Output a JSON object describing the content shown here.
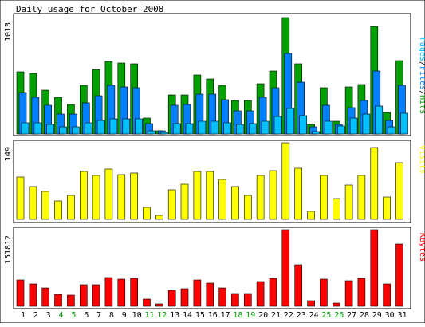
{
  "title": "Daily usage for October 2008",
  "days": [
    "1",
    "2",
    "3",
    "4",
    "5",
    "6",
    "7",
    "8",
    "9",
    "10",
    "11",
    "12",
    "13",
    "14",
    "15",
    "16",
    "17",
    "18",
    "19",
    "20",
    "21",
    "22",
    "23",
    "24",
    "25",
    "26",
    "27",
    "28",
    "29",
    "30",
    "31"
  ],
  "weekend_days": [
    "4",
    "5",
    "11",
    "12",
    "18",
    "19",
    "25",
    "26"
  ],
  "panels": {
    "top": {
      "max_label": "1013",
      "legend": {
        "pages": "Pages",
        "sep1": "/",
        "files": "Files",
        "sep2": "/",
        "hits": "Hits"
      }
    },
    "middle": {
      "max_label": "149",
      "legend": "Visits"
    },
    "bottom": {
      "max_label": "151812",
      "legend": "KBytes"
    }
  },
  "colors": {
    "hits": "#00a000",
    "files": "#0080ff",
    "pages": "#00c0ff",
    "visits": "#ffff00",
    "kbytes": "#ff0000",
    "weekend_text": "#00a000",
    "weekday_text": "#000000",
    "border": "#000000",
    "panel_bg": "#ffffff",
    "page_bg": "#ffffff"
  },
  "chart_data": [
    {
      "type": "bar",
      "title": "Daily usage for October 2008",
      "categories": [
        "1",
        "2",
        "3",
        "4",
        "5",
        "6",
        "7",
        "8",
        "9",
        "10",
        "11",
        "12",
        "13",
        "14",
        "15",
        "16",
        "17",
        "18",
        "19",
        "20",
        "21",
        "22",
        "23",
        "24",
        "25",
        "26",
        "27",
        "28",
        "29",
        "30",
        "31"
      ],
      "ylim": [
        0,
        1013
      ],
      "series": [
        {
          "name": "Hits",
          "values": [
            540,
            530,
            380,
            320,
            260,
            420,
            560,
            630,
            620,
            610,
            140,
            30,
            340,
            340,
            510,
            480,
            420,
            290,
            290,
            440,
            550,
            1013,
            610,
            80,
            400,
            110,
            410,
            430,
            940,
            190,
            640
          ]
        },
        {
          "name": "Files",
          "values": [
            360,
            320,
            250,
            170,
            170,
            270,
            330,
            420,
            410,
            400,
            90,
            25,
            250,
            260,
            350,
            350,
            300,
            200,
            200,
            320,
            400,
            700,
            450,
            60,
            250,
            80,
            230,
            290,
            550,
            120,
            420
          ]
        },
        {
          "name": "Pages",
          "values": [
            100,
            100,
            80,
            60,
            60,
            100,
            120,
            130,
            130,
            130,
            30,
            15,
            90,
            90,
            110,
            110,
            100,
            80,
            90,
            110,
            150,
            220,
            160,
            20,
            110,
            70,
            140,
            170,
            240,
            60,
            180
          ]
        }
      ]
    },
    {
      "type": "bar",
      "categories": [
        "1",
        "2",
        "3",
        "4",
        "5",
        "6",
        "7",
        "8",
        "9",
        "10",
        "11",
        "12",
        "13",
        "14",
        "15",
        "16",
        "17",
        "18",
        "19",
        "20",
        "21",
        "22",
        "23",
        "24",
        "25",
        "26",
        "27",
        "28",
        "29",
        "30",
        "31"
      ],
      "ylim": [
        0,
        149
      ],
      "series": [
        {
          "name": "Visits",
          "values": [
            83,
            63,
            55,
            36,
            46,
            93,
            86,
            98,
            87,
            90,
            24,
            7,
            58,
            69,
            93,
            93,
            77,
            64,
            46,
            85,
            95,
            149,
            99,
            16,
            85,
            40,
            66,
            85,
            140,
            44,
            110
          ]
        }
      ]
    },
    {
      "type": "bar",
      "categories": [
        "1",
        "2",
        "3",
        "4",
        "5",
        "6",
        "7",
        "8",
        "9",
        "10",
        "11",
        "12",
        "13",
        "14",
        "15",
        "16",
        "17",
        "18",
        "19",
        "20",
        "21",
        "22",
        "23",
        "24",
        "25",
        "26",
        "27",
        "28",
        "29",
        "30",
        "31"
      ],
      "ylim": [
        0,
        151812
      ],
      "series": [
        {
          "name": "KBytes",
          "values": [
            52000,
            45000,
            36000,
            23000,
            22000,
            43000,
            43000,
            57000,
            54000,
            56000,
            15000,
            4800,
            32000,
            35000,
            52000,
            46000,
            36000,
            25000,
            25000,
            49000,
            55000,
            151812,
            82000,
            11000,
            53000,
            5600,
            50000,
            56000,
            151812,
            44000,
            123000
          ]
        }
      ]
    }
  ]
}
